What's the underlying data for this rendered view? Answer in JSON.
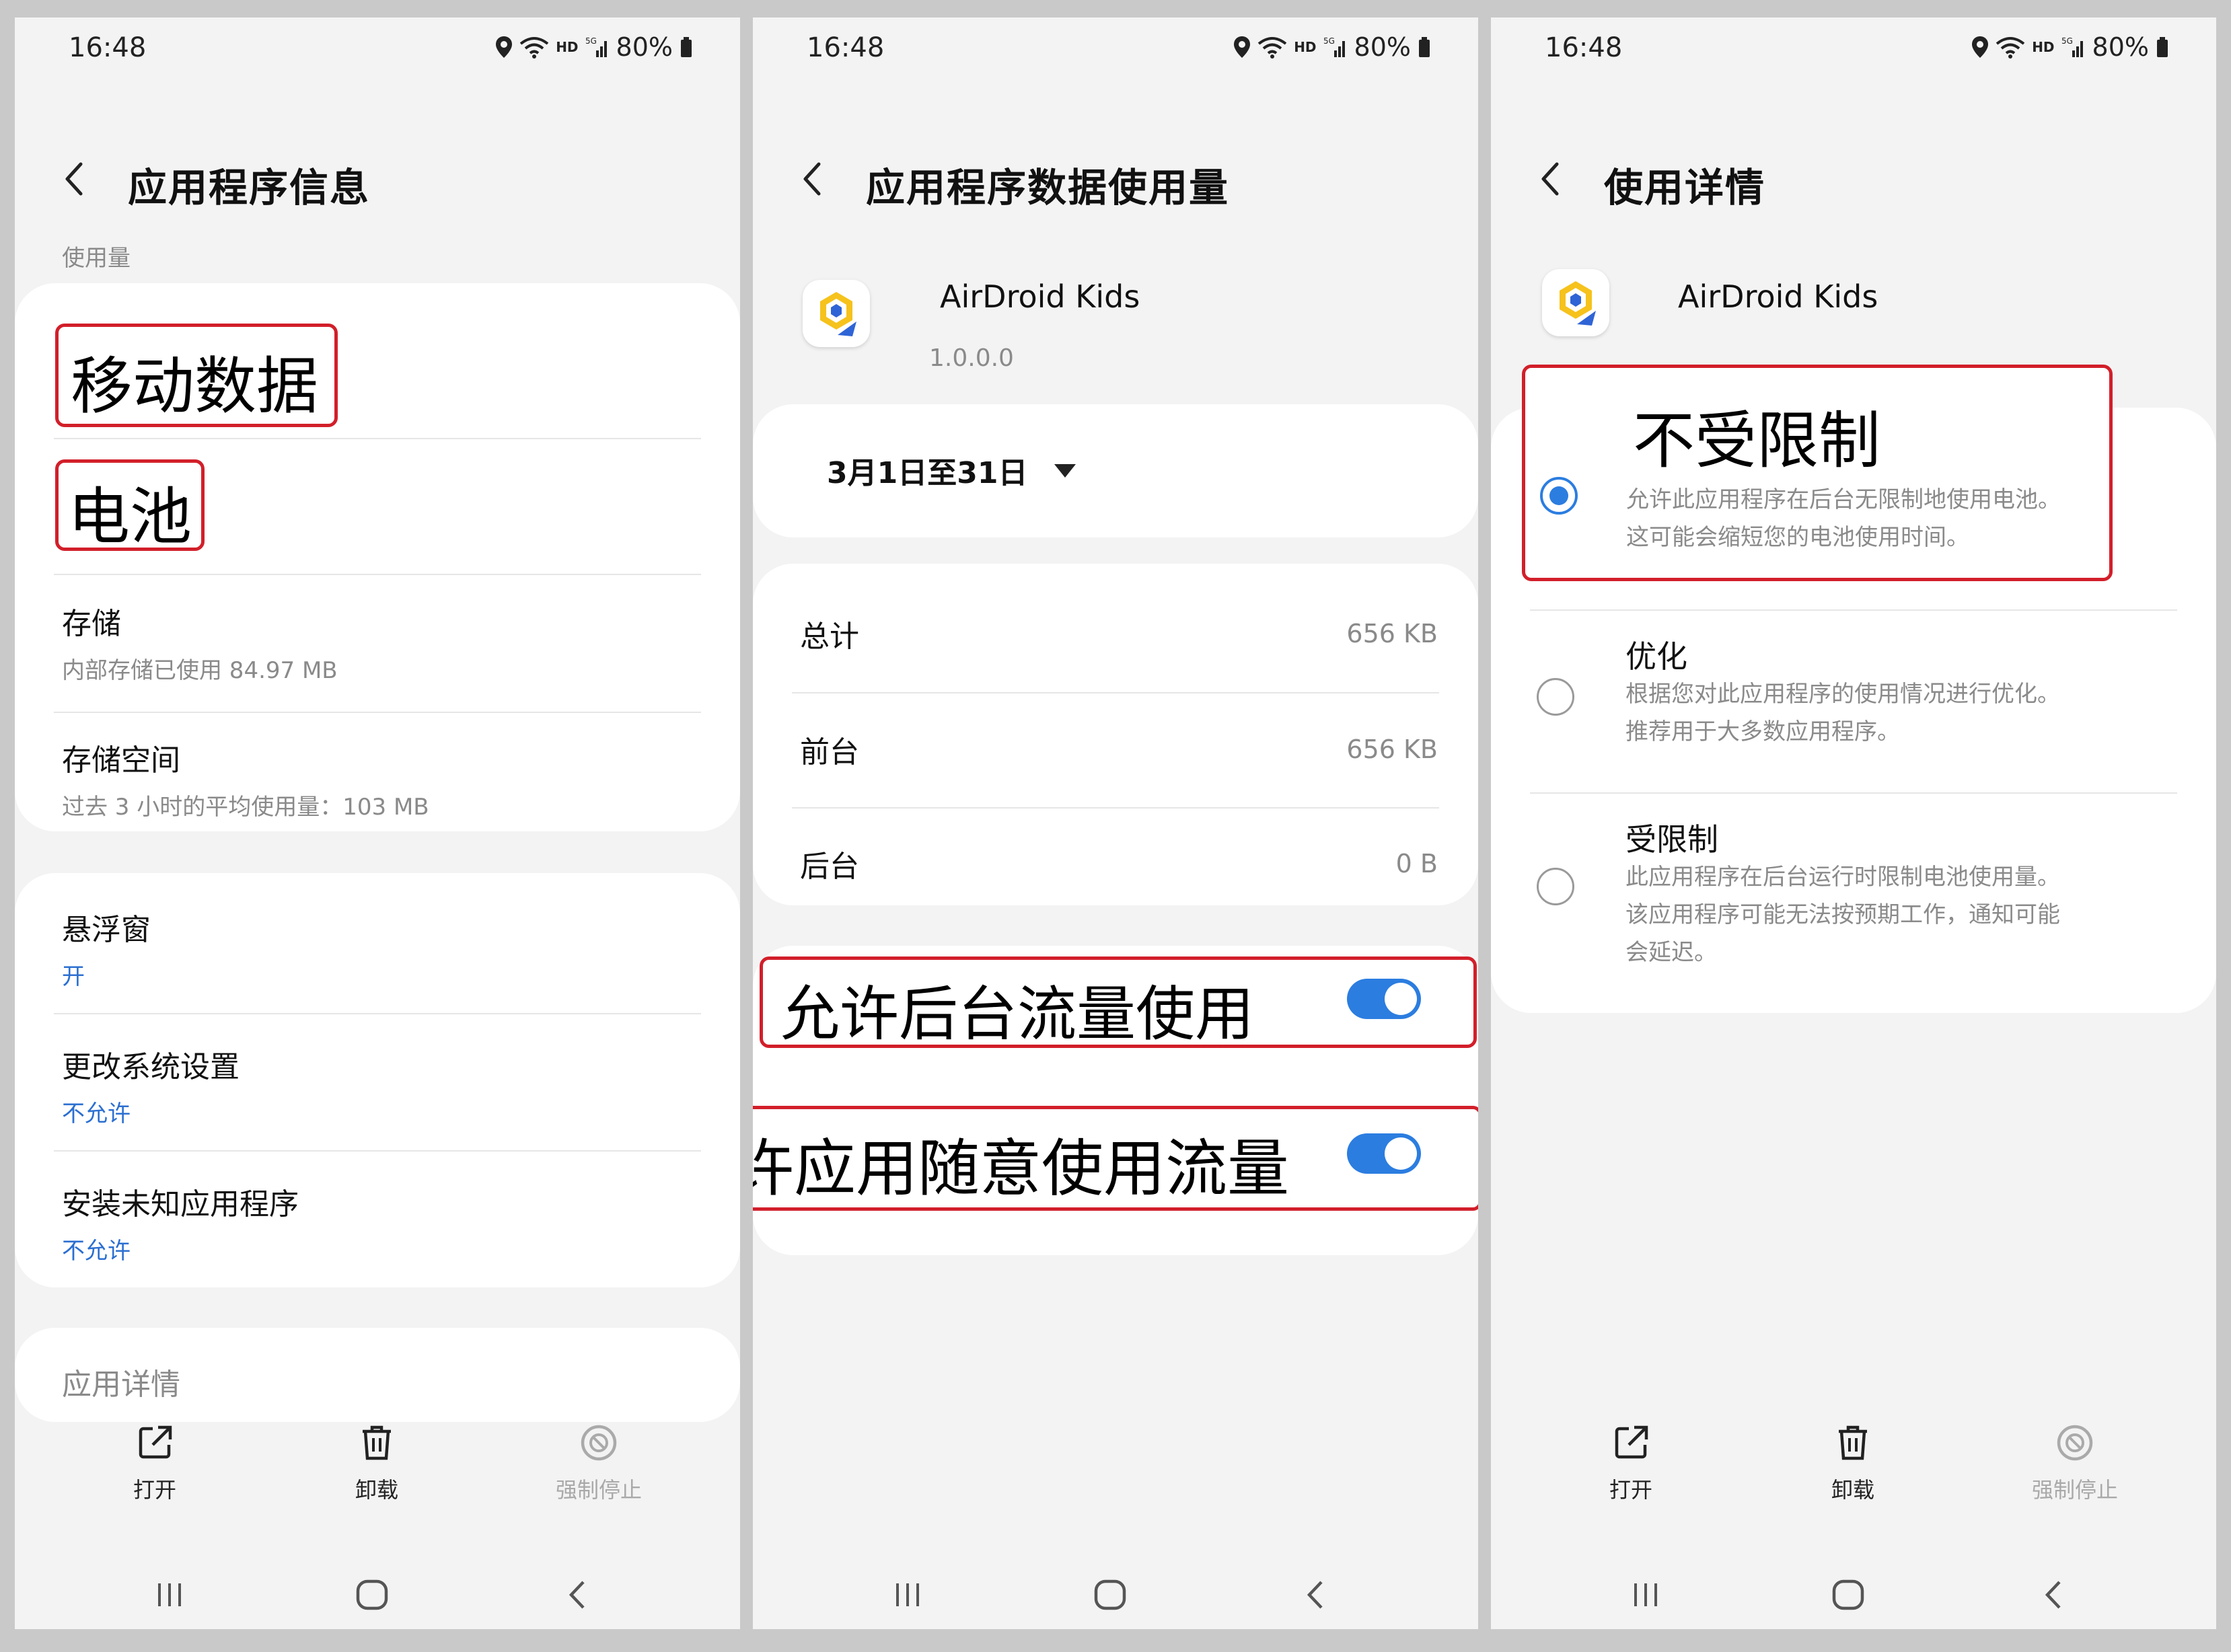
{
  "status": {
    "time": "16:48",
    "network": "HD",
    "network_gen": "5G",
    "battery": "80%"
  },
  "colors": {
    "accent": "#2b7de0",
    "highlight_border": "#d21f2a",
    "link_blue": "#2b6fd1"
  },
  "screen1": {
    "title": "应用程序信息",
    "usage_label": "使用量",
    "mobile_data": "移动数据",
    "battery": "电池",
    "storage_title": "存储",
    "storage_sub": "内部存储已使用 84.97 MB",
    "memory_title": "存储空间",
    "memory_sub": "过去 3 小时的平均使用量：103 MB",
    "overlay_title": "悬浮窗",
    "overlay_sub": "开",
    "modify_title": "更改系统设置",
    "modify_sub": "不允许",
    "install_title": "安装未知应用程序",
    "install_sub": "不允许",
    "app_details": "应用详情",
    "actions": {
      "open": "打开",
      "uninstall": "卸载",
      "force_stop": "强制停止"
    }
  },
  "screen2": {
    "title": "应用程序数据使用量",
    "app_name": "AirDroid Kids",
    "app_version": "1.0.0.0",
    "date_range": "3月1日至31日",
    "rows": [
      {
        "label": "总计",
        "value": "656 KB"
      },
      {
        "label": "前台",
        "value": "656 KB"
      },
      {
        "label": "后台",
        "value": "0 B"
      }
    ],
    "allow_background": "允许后台流量使用",
    "allow_unrestricted": "允许应用随意使用流量",
    "allow_background_on": true,
    "allow_unrestricted_on": true
  },
  "screen3": {
    "title": "使用详情",
    "app_name": "AirDroid Kids",
    "options": [
      {
        "title": "不受限制",
        "desc1": "允许此应用程序在后台无限制地使用电池。",
        "desc2": "这可能会缩短您的电池使用时间。",
        "desc3": "",
        "selected": true
      },
      {
        "title": "优化",
        "desc1": "根据您对此应用程序的使用情况进行优化。",
        "desc2": "推荐用于大多数应用程序。",
        "desc3": "",
        "selected": false
      },
      {
        "title": "受限制",
        "desc1": "此应用程序在后台运行时限制电池使用量。",
        "desc2": "该应用程序可能无法按预期工作，通知可能",
        "desc3": "会延迟。",
        "selected": false
      }
    ],
    "actions": {
      "open": "打开",
      "uninstall": "卸载",
      "force_stop": "强制停止"
    }
  }
}
